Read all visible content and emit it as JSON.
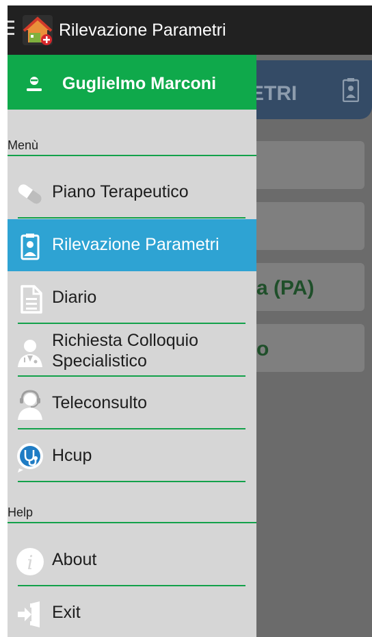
{
  "app_bar": {
    "title": "Rilevazione Parametri"
  },
  "background": {
    "header_text": "ETRI",
    "card3_text": "a (PA)",
    "card4_text": "o"
  },
  "drawer": {
    "user_name": "Guglielmo Marconi",
    "sections": {
      "menu_label": "Menù",
      "help_label": "Help"
    },
    "menu_items": [
      {
        "label": "Piano Terapeutico",
        "icon": "pill-icon",
        "selected": false
      },
      {
        "label": "Rilevazione Parametri",
        "icon": "clipboard-person-icon",
        "selected": true
      },
      {
        "label": "Diario",
        "icon": "document-icon",
        "selected": false
      },
      {
        "label_line1": "Richiesta Colloquio",
        "label_line2": "Specialistico",
        "icon": "doctor-icon",
        "selected": false
      },
      {
        "label": "Teleconsulto",
        "icon": "headset-operator-icon",
        "selected": false
      },
      {
        "label": "Hcup",
        "icon": "stethoscope-chat-icon",
        "selected": false
      }
    ],
    "help_items": [
      {
        "label": "About",
        "icon": "info-icon"
      },
      {
        "label": "Exit",
        "icon": "exit-icon"
      }
    ]
  },
  "colors": {
    "appbar": "#212121",
    "drawer_header": "#0fa94b",
    "selected_item": "#2ea3d3",
    "drawer_bg": "#d6d6d6",
    "divider": "#12a14a"
  }
}
